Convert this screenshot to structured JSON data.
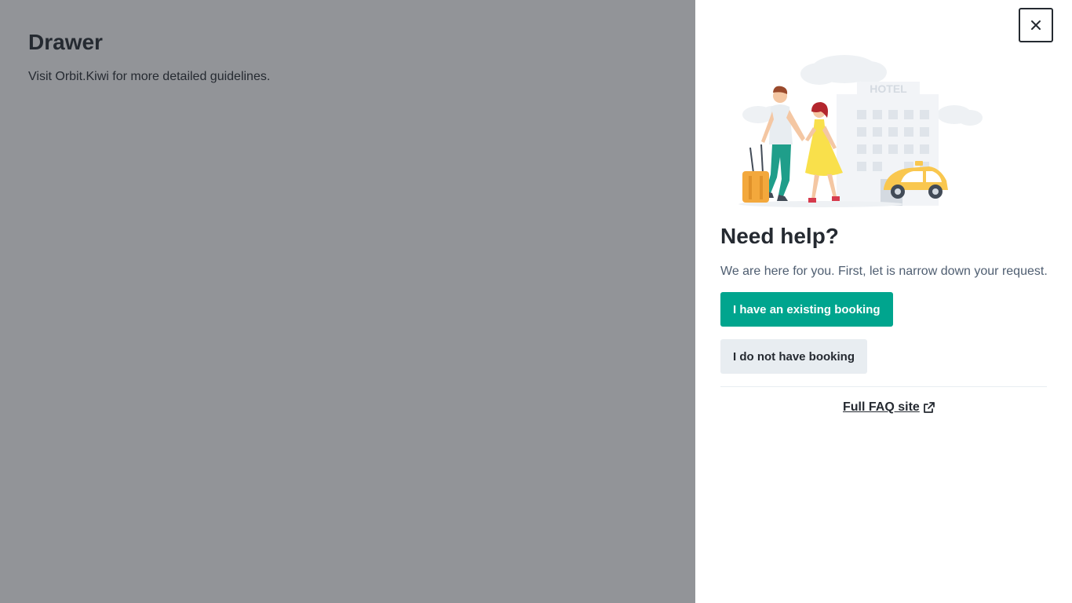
{
  "page": {
    "title": "Drawer",
    "description": "Visit Orbit.Kiwi for more detailed guidelines."
  },
  "drawer": {
    "close_icon": "close-icon",
    "illustration": {
      "hotel_sign": "HOTEL",
      "description_icon": "hotel-couple-taxi-illustration"
    },
    "title": "Need help?",
    "description": "We are here for you. First, let is narrow down your request.",
    "primary_button": "I have an existing booking",
    "secondary_button": "I do not have booking",
    "faq_link": "Full FAQ site",
    "faq_icon": "external-link-icon"
  },
  "colors": {
    "accent": "#00a58e",
    "text": "#252a31",
    "secondary_bg": "#e8edf1"
  }
}
